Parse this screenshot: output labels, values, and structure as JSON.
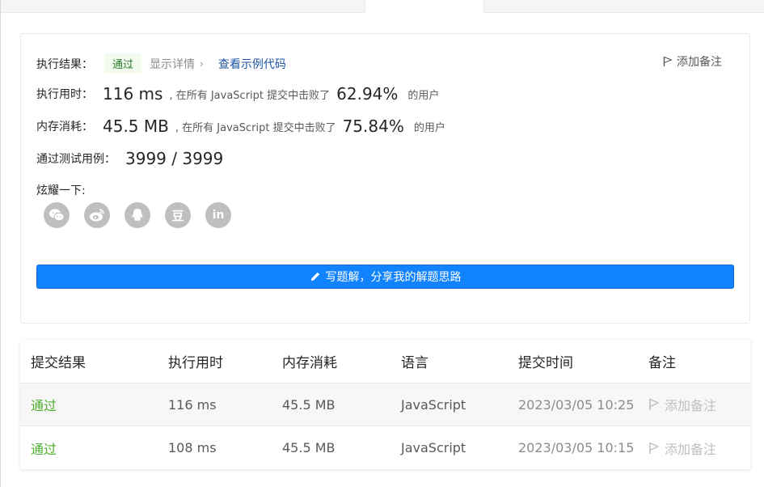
{
  "result": {
    "status_label": "执行结果：",
    "status": "通过",
    "details_link": "显示详情",
    "details_chevron": "›",
    "sample_code_link": "查看示例代码",
    "add_note": "添加备注",
    "runtime_label": "执行用时：",
    "runtime_value": "116 ms",
    "runtime_text": ", 在所有 JavaScript 提交中击败了",
    "runtime_pct": "62.94%",
    "runtime_suffix": "的用户",
    "memory_label": "内存消耗：",
    "memory_value": "45.5 MB",
    "memory_text": ", 在所有 JavaScript 提交中击败了",
    "memory_pct": "75.84%",
    "memory_suffix": "的用户",
    "testcases_label": "通过测试用例：",
    "testcases_value": "3999 / 3999",
    "share_label": "炫耀一下:",
    "share_icons": [
      "wechat-icon",
      "weibo-icon",
      "qq-icon",
      "douban-icon",
      "linkedin-icon"
    ],
    "douban_glyph": "豆",
    "linkedin_glyph": "in",
    "solution_button": "写题解，分享我的解题思路"
  },
  "table": {
    "headers": [
      "提交结果",
      "执行用时",
      "内存消耗",
      "语言",
      "提交时间",
      "备注"
    ],
    "rows": [
      {
        "status": "通过",
        "runtime": "116 ms",
        "memory": "45.5 MB",
        "language": "JavaScript",
        "time": "2023/03/05 10:25",
        "note": "添加备注"
      },
      {
        "status": "通过",
        "runtime": "108 ms",
        "memory": "45.5 MB",
        "language": "JavaScript",
        "time": "2023/03/05 10:15",
        "note": "添加备注"
      }
    ]
  },
  "colors": {
    "accent": "#1183ff",
    "accepted": "#4caf2a",
    "link": "#1f55a6",
    "share_icon_bg": "#bfbfbf"
  }
}
